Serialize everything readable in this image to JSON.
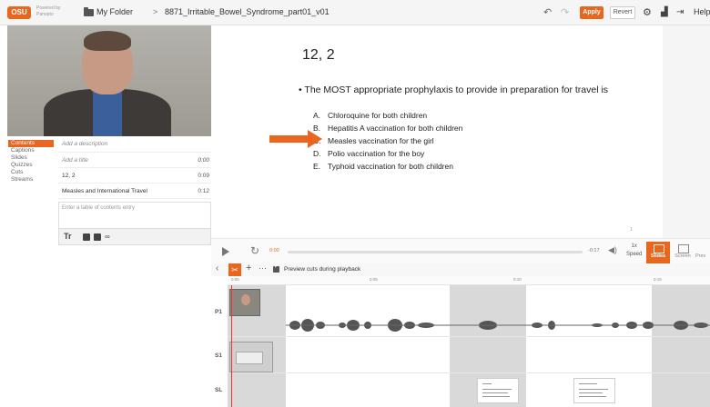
{
  "topbar": {
    "logo_text": "OSU",
    "powered_by": "Powered by Panopto",
    "breadcrumb_folder": "My Folder",
    "breadcrumb_separator": ">",
    "breadcrumb_file": "8871_Irritable_Bowel_Syndrome_part01_v01",
    "undo_icon": "undo-icon",
    "redo_icon": "redo-icon",
    "apply_label": "Apply",
    "revert_label": "Revert",
    "settings_icon": "gear-icon",
    "stats_icon": "stats-icon",
    "share_icon": "share-icon",
    "help_label": "Help"
  },
  "left_nav": {
    "items": [
      "Contents",
      "Captions",
      "Slides",
      "Quizzes",
      "Cuts",
      "Streams"
    ],
    "active": "Contents"
  },
  "toc": {
    "description_placeholder": "Add a description",
    "rows": [
      {
        "title": "Add a title",
        "time": "0:00",
        "placeholder": true
      },
      {
        "title": "12, 2",
        "time": "0:09",
        "placeholder": false
      },
      {
        "title": "Measles and International Travel",
        "time": "0:12",
        "placeholder": false
      }
    ],
    "entry_placeholder": "Enter a table of contents entry",
    "tool_text_label": "Tr"
  },
  "slide": {
    "title": "12, 2",
    "question": "The MOST appropriate prophylaxis to provide in preparation for travel is",
    "options": [
      {
        "letter": "A.",
        "text": "Chloroquine for both children"
      },
      {
        "letter": "B.",
        "text": "Hepatitis A vaccination for both children"
      },
      {
        "letter": "C.",
        "text": "Measles vaccination for the girl"
      },
      {
        "letter": "D.",
        "text": "Polio vaccination for the boy"
      },
      {
        "letter": "E.",
        "text": "Typhoid vaccination for both children"
      }
    ],
    "page_indicator": "1",
    "arrow_color": "#e8661e"
  },
  "player": {
    "current_time": "0:00",
    "remaining_time": "-0:17",
    "speed_value": "1x",
    "speed_label": "Speed",
    "slides_label": "Slides",
    "screen_label": "Screen",
    "preview_label": "Prev"
  },
  "editor": {
    "preview_cuts_label": "Preview cuts during playback",
    "preview_cuts_checked": true,
    "ruler_ticks": [
      "0:00",
      "0:05",
      "0:10",
      "0:15"
    ],
    "tracks": [
      "P1",
      "S1",
      "SL"
    ]
  },
  "colors": {
    "accent": "#e8661e"
  }
}
